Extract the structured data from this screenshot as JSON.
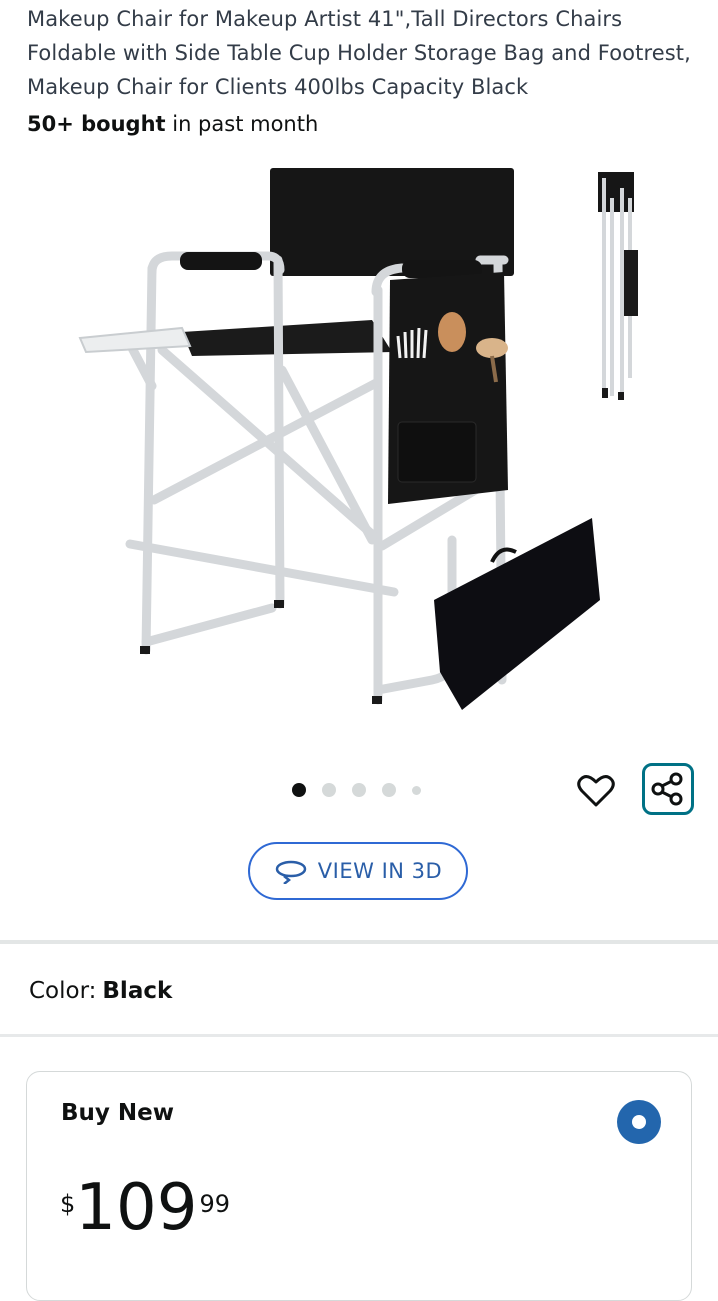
{
  "product": {
    "title": "Makeup Chair for Makeup Artist 41\",Tall Directors Chairs Foldable with Side Table Cup Holder Storage Bag and Footrest, Makeup Chair for Clients 400lbs Capacity Black",
    "bought_count": "50+ bought",
    "bought_suffix": " in past month"
  },
  "gallery": {
    "image_count": 5,
    "active_index": 0,
    "view_3d_label": "VIEW IN 3D",
    "icons": [
      "heart-icon",
      "share-icon",
      "rotate-3d-icon"
    ],
    "accent_color": "#007185"
  },
  "variant": {
    "color_label": "Color:",
    "color_value": "Black"
  },
  "buy_box": {
    "title": "Buy New",
    "price_symbol": "$",
    "price_whole": "109",
    "price_fraction": "99",
    "radio_color": "#2366ad"
  }
}
